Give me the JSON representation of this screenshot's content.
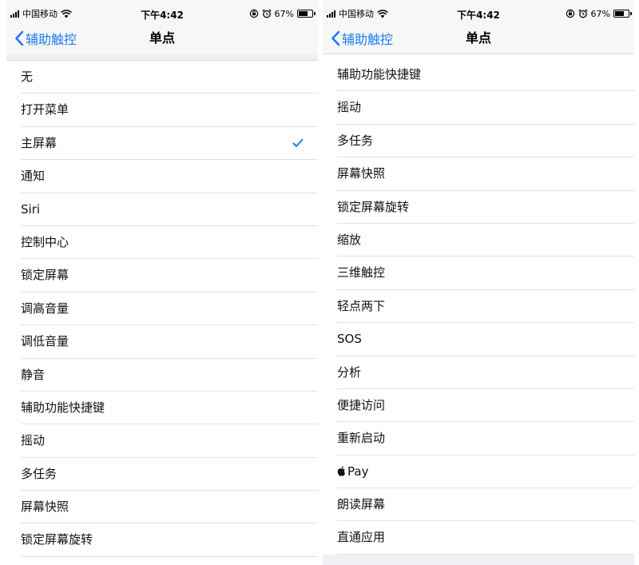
{
  "status_bar": {
    "carrier": "中国移动",
    "time": "下午4:42",
    "battery_percent": "67%",
    "battery_level": 0.67,
    "icons": [
      "signal-icon",
      "wifi-icon",
      "rotation-lock-icon",
      "alarm-icon",
      "battery-icon"
    ]
  },
  "nav": {
    "back_label": "辅助触控",
    "title": "单点"
  },
  "colors": {
    "accent": "#1a7cf5",
    "bar_background": "#f7f7f7",
    "group_background": "#efeff4",
    "separator": "#e2e2e4"
  },
  "left_list": {
    "items": [
      {
        "label": "无",
        "selected": false
      },
      {
        "label": "打开菜单",
        "selected": false
      },
      {
        "label": "主屏幕",
        "selected": true
      },
      {
        "label": "通知",
        "selected": false
      },
      {
        "label": "Siri",
        "selected": false
      },
      {
        "label": "控制中心",
        "selected": false
      },
      {
        "label": "锁定屏幕",
        "selected": false
      },
      {
        "label": "调高音量",
        "selected": false
      },
      {
        "label": "调低音量",
        "selected": false
      },
      {
        "label": "静音",
        "selected": false
      },
      {
        "label": "辅助功能快捷键",
        "selected": false
      },
      {
        "label": "摇动",
        "selected": false
      },
      {
        "label": "多任务",
        "selected": false
      },
      {
        "label": "屏幕快照",
        "selected": false
      },
      {
        "label": "锁定屏幕旋转",
        "selected": false
      }
    ]
  },
  "right_list": {
    "items": [
      {
        "label": "辅助功能快捷键",
        "selected": false
      },
      {
        "label": "摇动",
        "selected": false
      },
      {
        "label": "多任务",
        "selected": false
      },
      {
        "label": "屏幕快照",
        "selected": false
      },
      {
        "label": "锁定屏幕旋转",
        "selected": false
      },
      {
        "label": "缩放",
        "selected": false
      },
      {
        "label": "三维触控",
        "selected": false
      },
      {
        "label": "轻点两下",
        "selected": false
      },
      {
        "label": "SOS",
        "selected": false
      },
      {
        "label": "分析",
        "selected": false
      },
      {
        "label": "便捷访问",
        "selected": false
      },
      {
        "label": "重新启动",
        "selected": false
      },
      {
        "label": "Pay",
        "selected": false,
        "icon": "apple-logo-icon"
      },
      {
        "label": "朗读屏幕",
        "selected": false
      },
      {
        "label": "直通应用",
        "selected": false
      }
    ]
  }
}
